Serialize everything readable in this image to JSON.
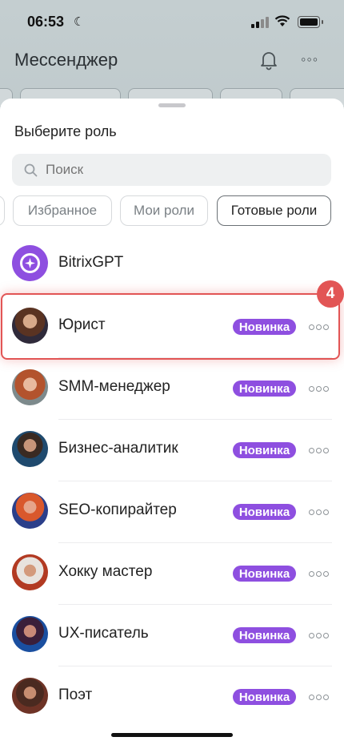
{
  "status_bar": {
    "time": "06:53",
    "moon_icon": "moon-icon",
    "signal_icon": "cellular-signal-icon",
    "wifi_icon": "wifi-icon",
    "battery_icon": "battery-icon"
  },
  "app": {
    "title": "Мессенджер",
    "bell_icon": "bell-icon",
    "more_icon": "more-horizontal-icon"
  },
  "sheet": {
    "title": "Выберите роль",
    "search": {
      "placeholder": "Поиск",
      "icon": "search-icon"
    },
    "filters": [
      {
        "label": "Избранное",
        "active": false
      },
      {
        "label": "Мои роли",
        "active": false
      },
      {
        "label": "Готовые роли",
        "active": true
      }
    ],
    "roles": [
      {
        "name": "BitrixGPT",
        "badge": "",
        "avatar": "bitrixgpt-logo-icon"
      },
      {
        "name": "Юрист",
        "badge": "Новинка",
        "avatar": "avatar-photo"
      },
      {
        "name": "SMM-менеджер",
        "badge": "Новинка",
        "avatar": "avatar-photo"
      },
      {
        "name": "Бизнес-аналитик",
        "badge": "Новинка",
        "avatar": "avatar-photo"
      },
      {
        "name": "SEO-копирайтер",
        "badge": "Новинка",
        "avatar": "avatar-photo"
      },
      {
        "name": "Хокку мастер",
        "badge": "Новинка",
        "avatar": "avatar-photo"
      },
      {
        "name": "UX-писатель",
        "badge": "Новинка",
        "avatar": "avatar-photo"
      },
      {
        "name": "Поэт",
        "badge": "Новинка",
        "avatar": "avatar-photo"
      }
    ],
    "badge_color": "#8e4fe0"
  },
  "annotation": {
    "step": "4",
    "color": "#e25555"
  }
}
